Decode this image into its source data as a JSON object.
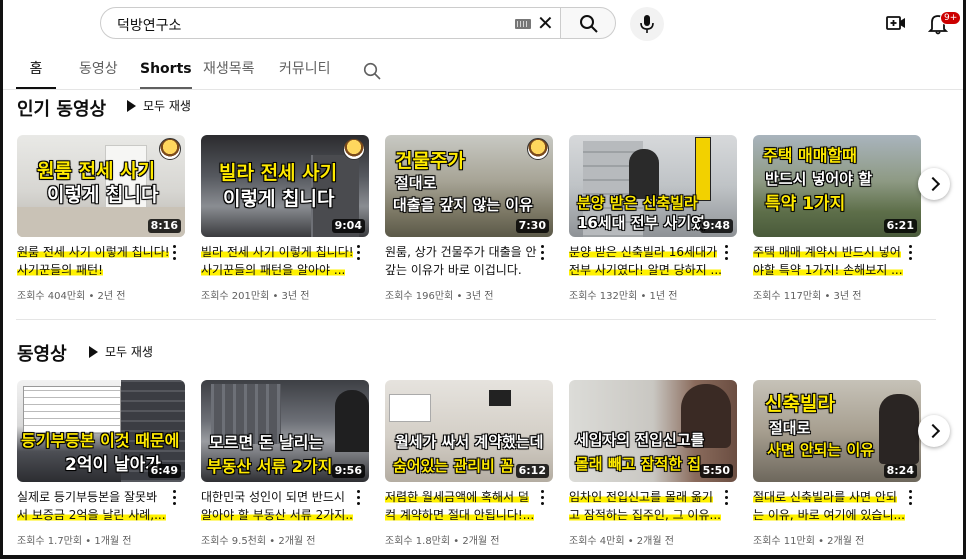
{
  "header": {
    "search_value": "덕방연구소",
    "notification_badge": "9+"
  },
  "tabs": [
    {
      "label": "홈"
    },
    {
      "label": "동영상"
    },
    {
      "label": "Shorts"
    },
    {
      "label": "재생목록"
    },
    {
      "label": "커뮤니티"
    }
  ],
  "sections": [
    {
      "title": "인기 동영상",
      "play_all": "모두 재생",
      "videos": [
        {
          "thumb_lines": [
            "원룸 전세 사기",
            "이렇게 칩니다"
          ],
          "duration": "8:16",
          "title_lines": [
            "원룸 전세 사기 이렇게 칩니다!",
            "사기꾼들의 패턴!"
          ],
          "meta": "조회수 404만회 • 2년 전"
        },
        {
          "thumb_lines": [
            "빌라 전세 사기",
            "이렇게 칩니다"
          ],
          "duration": "9:04",
          "title_lines": [
            "빌라 전세 사기 이렇게 칩니다!",
            "사기꾼들의 패턴을 알아야 ..."
          ],
          "meta": "조회수 201만회 • 3년 전"
        },
        {
          "thumb_lines": [
            "건물주가",
            "절대로",
            "대출을 갚지 않는 이유"
          ],
          "duration": "7:30",
          "title_lines": [
            "원룸, 상가 건물주가 대출을 안",
            "갚는 이유가 바로 이겁니다."
          ],
          "meta": "조회수 196만회 • 3년 전"
        },
        {
          "thumb_lines": [
            "분양 받은 신축빌라",
            "16세대 전부 사기였"
          ],
          "duration": "9:48",
          "title_lines": [
            "분양 받은 신축빌라 16세대가",
            "전부 사기였다! 알면 당하지 ..."
          ],
          "meta": "조회수 132만회 • 1년 전"
        },
        {
          "thumb_lines": [
            "주택 매매할때",
            "반드시 넣어야 할",
            "특약 1가지"
          ],
          "duration": "6:21",
          "title_lines": [
            "주택 매매 계약시 반드시 넣어",
            "야할 특약 1가지! 손해보지 ..."
          ],
          "meta": "조회수 117만회 • 3년 전"
        }
      ]
    },
    {
      "title": "동영상",
      "play_all": "모두 재생",
      "videos": [
        {
          "thumb_lines": [
            "등기부등본 이것 때문에",
            "2억이 날아가"
          ],
          "duration": "6:49",
          "title_lines": [
            "실제로 등기부등본을 잘못봐",
            "서 보증금 2억을 날린 사례,..."
          ],
          "meta": "조회수 1.7만회 • 1개월 전"
        },
        {
          "thumb_lines": [
            "모르면 돈 날리는",
            "부동산 서류 2가지"
          ],
          "duration": "9:56",
          "title_lines": [
            "대한민국 성인이 되면 반드시",
            "알아야 할 부동산 서류 2가지..."
          ],
          "meta": "조회수 9.5천회 • 2개월 전"
        },
        {
          "thumb_lines": [
            "월세가 싸서 계약했는데",
            "숨어있는 관리비 꼼"
          ],
          "duration": "6:12",
          "title_lines": [
            "저렴한 월세금액에 혹해서 덜",
            "컥 계약하면 절대 안됩니다!..."
          ],
          "meta": "조회수 1.8만회 • 2개월 전"
        },
        {
          "thumb_lines": [
            "세입자의 전입신고를",
            "몰래 빼고 잠적한 집"
          ],
          "duration": "5:50",
          "title_lines": [
            "임차인 전입신고를 몰래 옮기",
            "고 잠적하는 집주인, 그 이유..."
          ],
          "meta": "조회수 4만회 • 2개월 전"
        },
        {
          "thumb_lines": [
            "신축빌라",
            "절대로",
            "사면 안되는 이유"
          ],
          "duration": "8:24",
          "title_lines": [
            "절대로 신축빌라를 사면 안되",
            "는 이유, 바로 여기에 있습니..."
          ],
          "meta": "조회수 11만회 • 2개월 전"
        }
      ]
    }
  ]
}
